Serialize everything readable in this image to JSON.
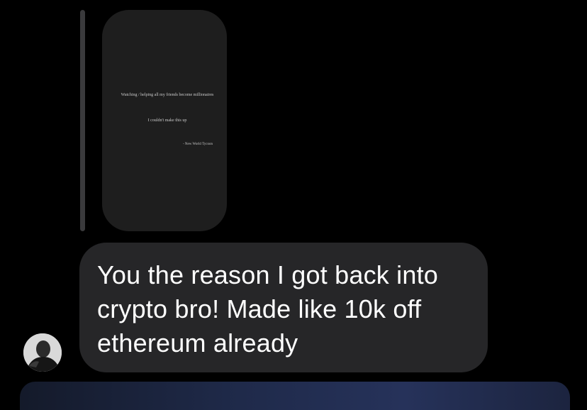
{
  "story_reply": {
    "line1": "Watching / helping all my friends become millionaires",
    "line2": "I couldn't make this up",
    "attribution": "- New World Tycoon"
  },
  "message": {
    "text": "You the reason I got back into crypto bro! Made like 10k off ethereum already"
  },
  "colors": {
    "background": "#000000",
    "incoming_bubble": "#262628",
    "story_card": "#1e1e1e",
    "reply_bar": "#3a3a3c",
    "message_text": "#ffffff"
  },
  "icons": {
    "avatar": "sender-avatar"
  }
}
